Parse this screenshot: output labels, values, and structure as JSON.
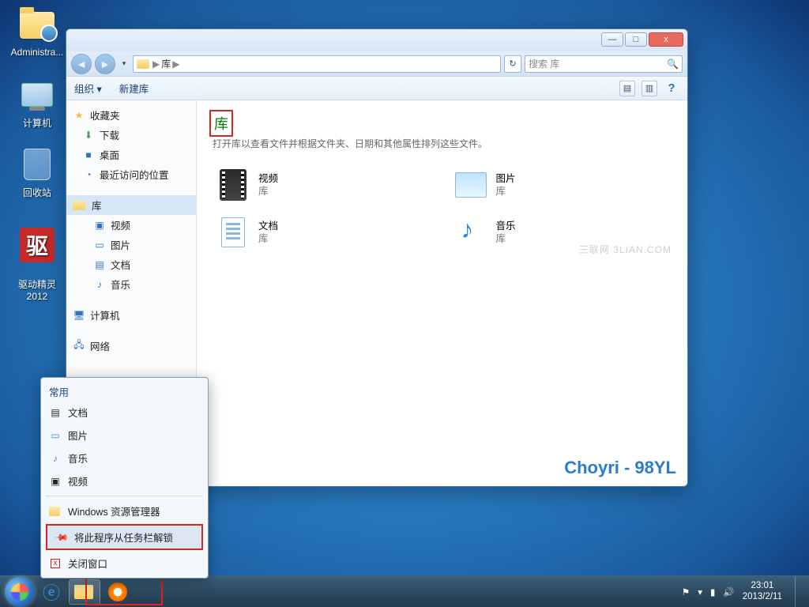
{
  "desktop": {
    "icons": [
      {
        "label": "Administra...",
        "type": "user-folder"
      },
      {
        "label": "计算机",
        "type": "computer"
      },
      {
        "label": "回收站",
        "type": "recycle-bin"
      },
      {
        "label": "驱动精灵\n2012",
        "type": "driver-genius",
        "glyph": "驱"
      }
    ]
  },
  "explorer": {
    "window_buttons": {
      "min": "—",
      "max": "□",
      "close": "x"
    },
    "breadcrumb": {
      "root": "库",
      "sep": "▶"
    },
    "refresh_glyph": "↻",
    "search_placeholder": "搜索 库",
    "cmdbar": {
      "organize": "组织",
      "organize_arrow": "▾",
      "new_library": "新建库",
      "view_glyph": "▤",
      "pane_glyph": "▥",
      "help_glyph": "?"
    },
    "nav": {
      "favorites": "收藏夹",
      "downloads": "下载",
      "desktop": "桌面",
      "recent": "最近访问的位置",
      "libraries": "库",
      "videos": "视频",
      "pictures": "图片",
      "documents": "文档",
      "music": "音乐",
      "computer": "计算机",
      "network": "网络"
    },
    "content": {
      "title": "库",
      "subtitle": "打开库以查看文件并根据文件夹、日期和其他属性排列这些文件。",
      "lib_caption": "库",
      "items": {
        "videos": "视频",
        "pictures": "图片",
        "documents": "文档",
        "music": "音乐"
      }
    },
    "watermark": "三联网 3LIAN.COM",
    "brand": "Choyri - 98YL"
  },
  "jumplist": {
    "header": "常用",
    "items": {
      "documents": "文档",
      "pictures": "图片",
      "music": "音乐",
      "videos": "视频"
    },
    "explorer": "Windows 资源管理器",
    "unpin": "将此程序从任务栏解锁",
    "close": "关闭窗口"
  },
  "tray": {
    "flag_glyph": "⚑",
    "battery_glyph": "▮",
    "net_glyph": "▾",
    "vol_glyph": "🔊",
    "time": "23:01",
    "date": "2013/2/11"
  }
}
